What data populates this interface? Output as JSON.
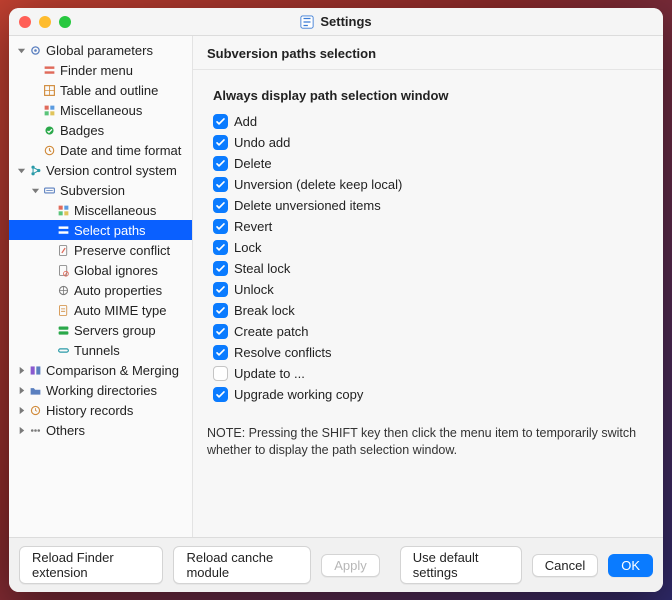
{
  "window": {
    "title": "Settings"
  },
  "sidebar": {
    "items": [
      {
        "label": "Global parameters",
        "indent": 0,
        "icon": "gear-icon",
        "disclosure": "open"
      },
      {
        "label": "Finder menu",
        "indent": 1,
        "icon": "finder-menu-icon"
      },
      {
        "label": "Table and outline",
        "indent": 1,
        "icon": "table-icon"
      },
      {
        "label": "Miscellaneous",
        "indent": 1,
        "icon": "grid-icon"
      },
      {
        "label": "Badges",
        "indent": 1,
        "icon": "badge-icon"
      },
      {
        "label": "Date and time format",
        "indent": 1,
        "icon": "clock-icon"
      },
      {
        "label": "Version control system",
        "indent": 0,
        "icon": "vcs-icon",
        "disclosure": "open"
      },
      {
        "label": "Subversion",
        "indent": 1,
        "icon": "svn-icon",
        "disclosure": "open"
      },
      {
        "label": "Miscellaneous",
        "indent": 2,
        "icon": "grid-icon"
      },
      {
        "label": "Select paths",
        "indent": 2,
        "icon": "paths-icon",
        "selected": true
      },
      {
        "label": "Preserve conflict",
        "indent": 2,
        "icon": "conflict-icon"
      },
      {
        "label": "Global ignores",
        "indent": 2,
        "icon": "ignore-icon"
      },
      {
        "label": "Auto properties",
        "indent": 2,
        "icon": "autoprops-icon"
      },
      {
        "label": "Auto MIME type",
        "indent": 2,
        "icon": "mime-icon"
      },
      {
        "label": "Servers group",
        "indent": 2,
        "icon": "servers-icon"
      },
      {
        "label": "Tunnels",
        "indent": 2,
        "icon": "tunnel-icon"
      },
      {
        "label": "Comparison & Merging",
        "indent": 0,
        "icon": "compare-icon",
        "disclosure": "closed"
      },
      {
        "label": "Working directories",
        "indent": 0,
        "icon": "folders-icon",
        "disclosure": "closed"
      },
      {
        "label": "History records",
        "indent": 0,
        "icon": "history-icon",
        "disclosure": "closed"
      },
      {
        "label": "Others",
        "indent": 0,
        "icon": "others-icon",
        "disclosure": "closed"
      }
    ]
  },
  "panel": {
    "title": "Subversion paths selection",
    "group_title": "Always display path selection window",
    "checks": [
      {
        "label": "Add",
        "checked": true
      },
      {
        "label": "Undo add",
        "checked": true
      },
      {
        "label": "Delete",
        "checked": true
      },
      {
        "label": "Unversion (delete keep local)",
        "checked": true
      },
      {
        "label": "Delete unversioned items",
        "checked": true
      },
      {
        "label": "Revert",
        "checked": true
      },
      {
        "label": "Lock",
        "checked": true
      },
      {
        "label": "Steal lock",
        "checked": true
      },
      {
        "label": "Unlock",
        "checked": true
      },
      {
        "label": "Break lock",
        "checked": true
      },
      {
        "label": "Create patch",
        "checked": true
      },
      {
        "label": "Resolve conflicts",
        "checked": true
      },
      {
        "label": "Update to ...",
        "checked": false
      },
      {
        "label": "Upgrade working copy",
        "checked": true
      }
    ],
    "note": "NOTE: Pressing the SHIFT key then click the menu item to temporarily switch whether to display the path selection window."
  },
  "footer": {
    "reload_finder": "Reload Finder extension",
    "reload_cache": "Reload canche module",
    "apply": "Apply",
    "use_defaults": "Use default settings",
    "cancel": "Cancel",
    "ok": "OK"
  }
}
